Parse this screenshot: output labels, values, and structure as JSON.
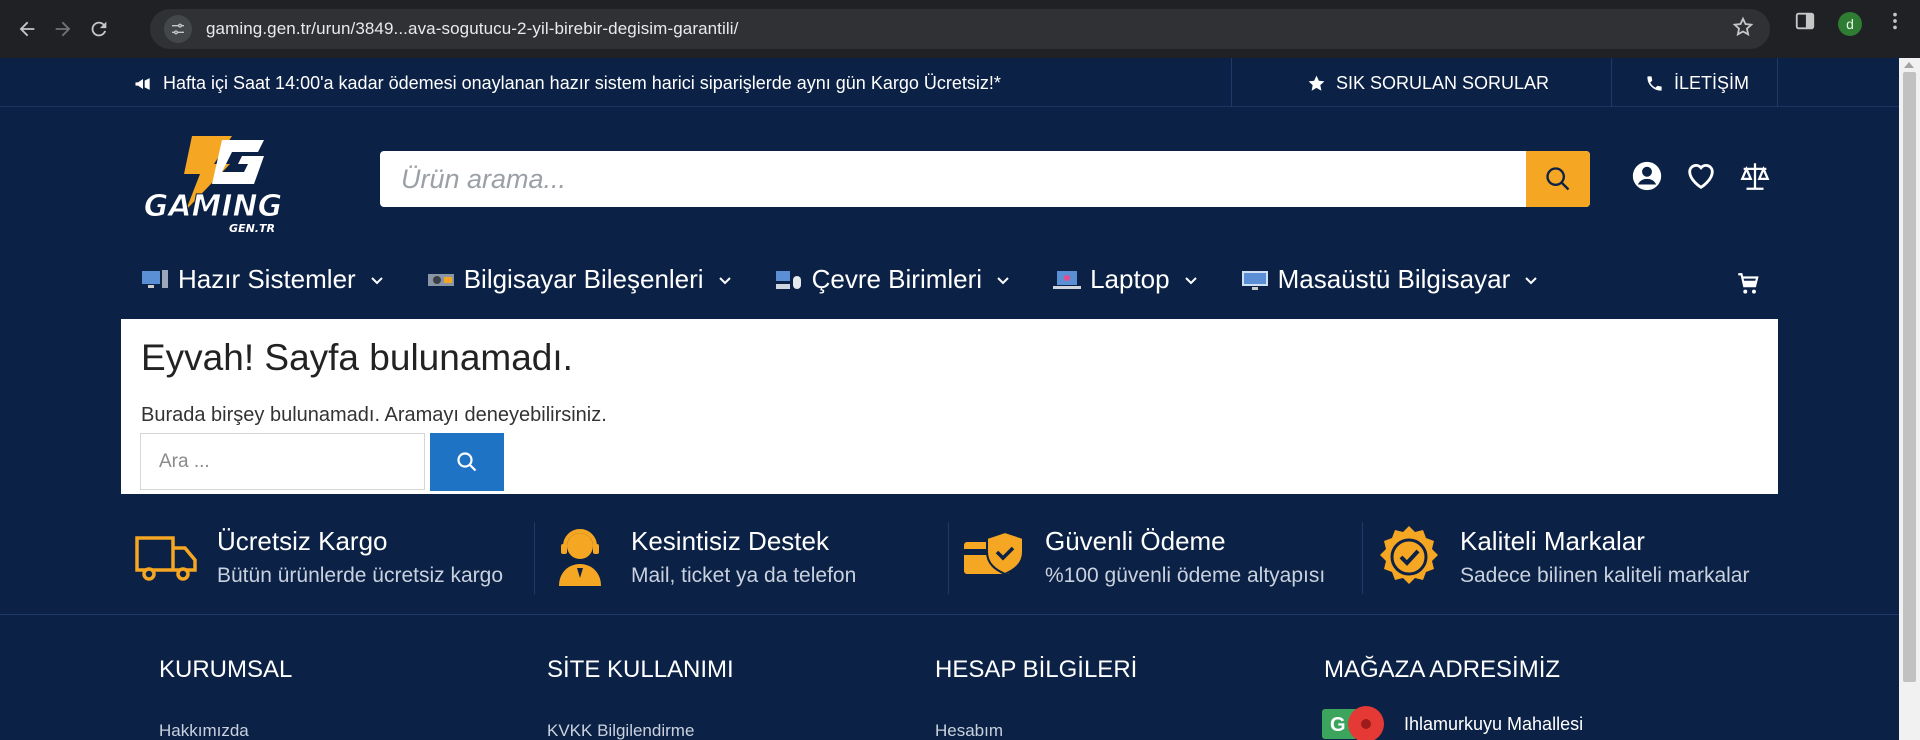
{
  "browser": {
    "url": "gaming.gen.tr/urun/3849...ava-sogutucu-2-yil-birebir-degisim-garantili/",
    "profile_initial": "d"
  },
  "topbar": {
    "announcement": "Hafta içi Saat 14:00'a kadar ödemesi onaylanan hazır sistem harici siparişlerde aynı gün Kargo Ücretsiz!*",
    "faq": "SIK SORULAN SORULAR",
    "contact": "İLETİŞİM"
  },
  "header": {
    "logo_text": "GAMING",
    "logo_sub": "GEN.TR",
    "search_placeholder": "Ürün arama..."
  },
  "menu": {
    "items": [
      {
        "label": "Hazır Sistemler"
      },
      {
        "label": "Bilgisayar Bileşenleri"
      },
      {
        "label": "Çevre Birimleri"
      },
      {
        "label": "Laptop"
      },
      {
        "label": "Masaüstü Bilgisayar"
      }
    ]
  },
  "content": {
    "title": "Eyvah! Sayfa bulunamadı.",
    "message": "Burada birşey bulunamadı. Aramayı deneyebilirsiniz.",
    "search_placeholder": "Ara ..."
  },
  "features": [
    {
      "title": "Ücretsiz Kargo",
      "desc": "Bütün ürünlerde ücretsiz kargo",
      "icon": "truck-icon"
    },
    {
      "title": "Kesintisiz Destek",
      "desc": "Mail, ticket ya da telefon",
      "icon": "support-agent-icon"
    },
    {
      "title": "Güvenli Ödeme",
      "desc": "%100 güvenli ödeme altyapısı",
      "icon": "secure-card-icon"
    },
    {
      "title": "Kaliteli Markalar",
      "desc": "Sadece bilinen kaliteli markalar",
      "icon": "quality-badge-icon"
    }
  ],
  "footer": {
    "columns": [
      {
        "heading": "KURUMSAL",
        "first_link": "Hakkımızda"
      },
      {
        "heading": "SİTE KULLANIMI",
        "first_link": "KVKK Bilgilendirme"
      },
      {
        "heading": "HESAP BİLGİLERİ",
        "first_link": "Hesabım"
      },
      {
        "heading": "MAĞAZA ADRESİMİZ",
        "first_link": ""
      }
    ],
    "store_address": "Ihlamurkuyu Mahallesi"
  },
  "colors": {
    "navy": "#0b2145",
    "accent": "#f5a623",
    "button_blue": "#1f73c4"
  }
}
